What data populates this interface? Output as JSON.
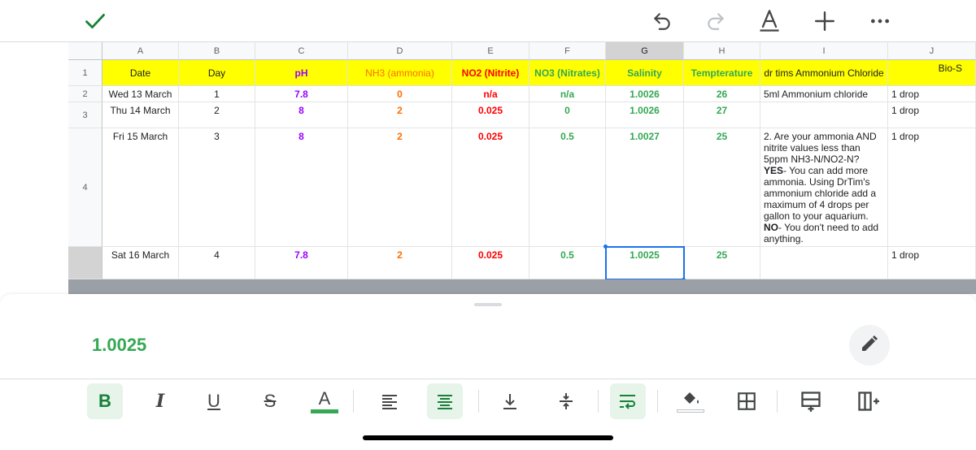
{
  "toolbar": {
    "icons": [
      "check-icon",
      "undo-icon",
      "redo-icon",
      "text-format-icon",
      "insert-plus-icon",
      "more-options-icon"
    ],
    "check_color": "#188038"
  },
  "grid": {
    "columns": [
      "A",
      "B",
      "C",
      "D",
      "E",
      "F",
      "G",
      "H",
      "I",
      "J"
    ],
    "selected_column": "G",
    "rows": [
      "1",
      "2",
      "3",
      "4",
      ""
    ],
    "header_row": {
      "date": "Date",
      "day": "Day",
      "ph": "pH",
      "nh3": "NH3 (ammonia)",
      "no2": "NO2 (Nitrite)",
      "no3": "NO3 (Nitrates)",
      "salinity": "Salinity",
      "temperature": "Tempterature",
      "ammonium": "dr tims Ammonium Chloride",
      "bio": "Bio-S"
    },
    "data_rows": [
      {
        "date": "Wed 13 March",
        "day": "1",
        "ph": "7.8",
        "nh3": "0",
        "no2": "n/a",
        "no3": "n/a",
        "salinity": "1.0026",
        "temperature": "26",
        "ammonium": "5ml Ammonium chloride",
        "bio": "1 drop"
      },
      {
        "date": "Thu 14 March",
        "day": "2",
        "ph": "8",
        "nh3": "2",
        "no2": "0.025",
        "no3": "0",
        "salinity": "1.0026",
        "temperature": "27",
        "ammonium": "",
        "bio": "1 drop"
      },
      {
        "date": "Fri 15 March",
        "day": "3",
        "ph": "8",
        "nh3": "2",
        "no2": "0.025",
        "no3": "0.5",
        "salinity": "1.0027",
        "temperature": "25",
        "ammonium_part1": "2. Are your ammonia AND nitrite values less than 5ppm NH3-N/NO2-N?",
        "ammonium_yes": "YES",
        "ammonium_part2": "- You can add more ammonia. Using DrTim's ammonium chloride add a maximum of 4 drops per gallon to your aquarium.",
        "ammonium_no": "NO",
        "ammonium_part3": "- You don't need to add anything.",
        "bio": "1 drop"
      },
      {
        "date": "Sat 16 March",
        "day": "4",
        "ph": "7.8",
        "nh3": "2",
        "no2": "0.025",
        "no3": "0.5",
        "salinity": "1.0025",
        "temperature": "25",
        "ammonium": "",
        "bio": "1 drop"
      }
    ]
  },
  "bottom_sheet": {
    "cell_value": "1.0025",
    "edit_icon": "pencil-icon",
    "format_buttons": [
      {
        "name": "bold-button",
        "label": "B",
        "active": true
      },
      {
        "name": "italic-button",
        "label": "I"
      },
      {
        "name": "underline-button",
        "label": "U"
      },
      {
        "name": "strikethrough-button",
        "label": "S"
      },
      {
        "name": "text-color-button",
        "label": "A"
      },
      {
        "name": "align-left-button",
        "label": ""
      },
      {
        "name": "align-center-button",
        "label": "",
        "active": true
      },
      {
        "name": "align-bottom-button",
        "label": ""
      },
      {
        "name": "align-middle-button",
        "label": ""
      },
      {
        "name": "wrap-text-button",
        "label": "",
        "active": true
      },
      {
        "name": "fill-color-button",
        "label": ""
      },
      {
        "name": "borders-button",
        "label": ""
      },
      {
        "name": "insert-row-button",
        "label": ""
      },
      {
        "name": "insert-column-button",
        "label": ""
      }
    ]
  },
  "colors": {
    "header_fill": "#ffff00",
    "selection": "#1a73e8",
    "ph": "#9900ff",
    "ammonia": "#ff6d01",
    "nitrite": "#ff0000",
    "green": "#34a853"
  }
}
